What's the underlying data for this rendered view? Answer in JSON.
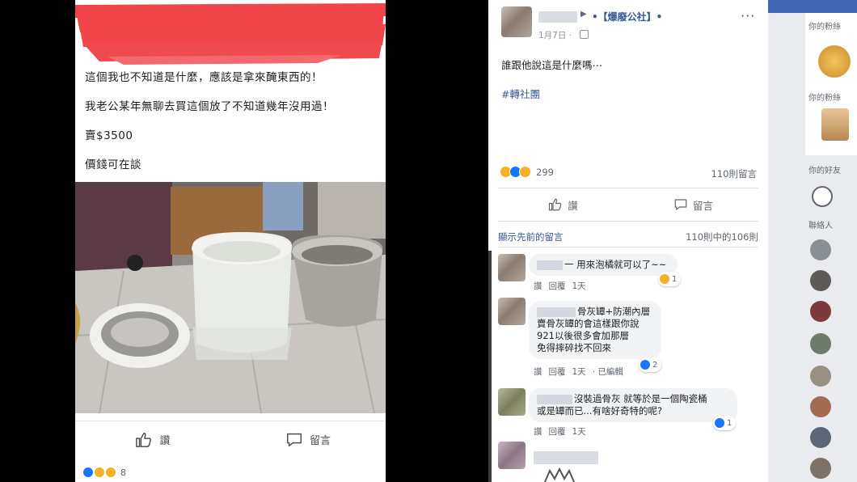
{
  "left_post": {
    "lines": [
      "這個我也不知道是什麼，應該是拿來醃東西的！",
      "我老公某年無聊去買這個放了不知道幾年沒用過！",
      "賣$3500",
      "價錢可在談"
    ],
    "like_label": "讚",
    "comment_label": "留言",
    "reaction_count": "8"
  },
  "right_post": {
    "group_name": "•【爆廢公社】•",
    "date": "1月7日 ·",
    "more_label": "···",
    "body": "誰跟他說這是什麼嗎⋯",
    "hashtag": "#轉社團",
    "reaction_count": "299",
    "comment_count": "110則留言",
    "like_label": "讚",
    "comment_label": "留言",
    "show_previous": "顯示先前的留言",
    "pager": "110則中的106則",
    "comments": [
      {
        "text_line1": "一 用來泡橘就可以了~~",
        "text_line2": "",
        "text_line3": "",
        "text_line4": "",
        "like": "讚",
        "reply": "回覆",
        "time": "1天",
        "edited": "",
        "react_count": "1"
      },
      {
        "text_line1": "骨灰罈+防潮內層",
        "text_line2": "賣骨灰罈的會這樣跟你說",
        "text_line3": "921以後很多會加那層",
        "text_line4": "免得摔碎找不回來",
        "like": "讚",
        "reply": "回覆",
        "time": "1天",
        "edited": "· 已編輯",
        "react_count": "2"
      },
      {
        "text_line1": "沒裝過骨灰 就等於是一個陶瓷桶",
        "text_line2": "或是罈而已...有啥好奇特的呢?",
        "text_line3": "",
        "text_line4": "",
        "like": "讚",
        "reply": "回覆",
        "time": "1天",
        "edited": "",
        "react_count": "1"
      }
    ]
  },
  "sidebar": {
    "title1": "你的粉絲",
    "title2": "你的粉絲",
    "title3": "你的好友",
    "title4": "聯絡人"
  },
  "colors": {
    "link_blue": "#365899",
    "facebook_blue": "#4267b2",
    "redaction_red": "#f0464a",
    "like_blue": "#1877f2",
    "haha_yellow": "#f7b125"
  }
}
